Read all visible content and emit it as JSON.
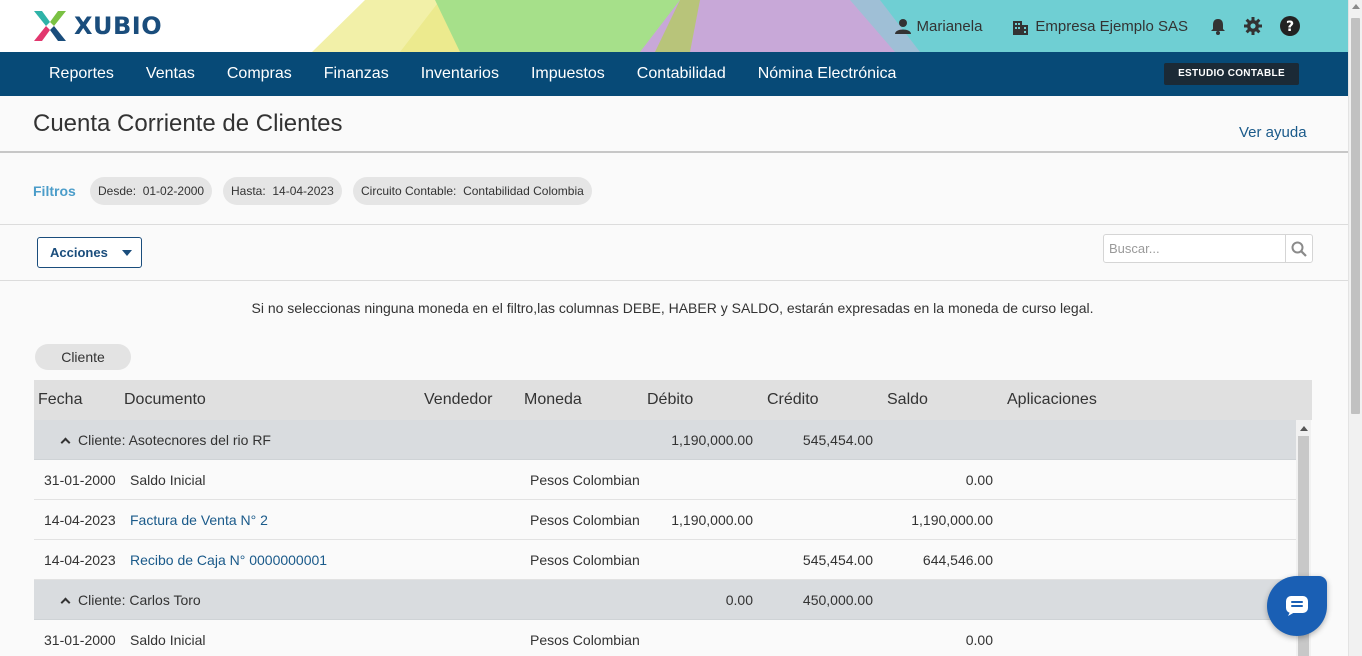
{
  "brand": {
    "name": "XUBIO"
  },
  "topbar": {
    "user": "Marianela",
    "company": "Empresa Ejemplo SAS",
    "icons": [
      "user-icon",
      "building-icon",
      "bell-icon",
      "gear-icon",
      "help-icon"
    ]
  },
  "nav": {
    "items": [
      "Reportes",
      "Ventas",
      "Compras",
      "Finanzas",
      "Inventarios",
      "Impuestos",
      "Contabilidad",
      "Nómina Electrónica"
    ],
    "studio_button": "ESTUDIO CONTABLE"
  },
  "page": {
    "title": "Cuenta Corriente de Clientes",
    "help_link": "Ver ayuda"
  },
  "filters": {
    "label": "Filtros",
    "chips": [
      {
        "name": "Desde:",
        "value": "01-02-2000"
      },
      {
        "name": "Hasta:",
        "value": "14-04-2023"
      },
      {
        "name": "Circuito Contable:",
        "value": "Contabilidad Colombia"
      }
    ]
  },
  "actions": {
    "label": "Acciones"
  },
  "search": {
    "placeholder": "Buscar..."
  },
  "notice": "Si no seleccionas ninguna moneda en el filtro,las columnas DEBE, HABER y SALDO, estarán expresadas en la moneda de curso legal.",
  "grouping_chip": "Cliente",
  "table": {
    "columns": [
      "Fecha",
      "Documento",
      "Vendedor",
      "Moneda",
      "Débito",
      "Crédito",
      "Saldo",
      "Aplicaciones"
    ],
    "groups": [
      {
        "label": "Cliente: Asotecnores del rio RF",
        "debito": "1,190,000.00",
        "credito": "545,454.00",
        "rows": [
          {
            "fecha": "31-01-2000",
            "documento": "Saldo Inicial",
            "link": false,
            "moneda": "Pesos Colombian",
            "debito": "",
            "credito": "",
            "saldo": "0.00"
          },
          {
            "fecha": "14-04-2023",
            "documento": "Factura de Venta N° 2",
            "link": true,
            "moneda": "Pesos Colombian",
            "debito": "1,190,000.00",
            "credito": "",
            "saldo": "1,190,000.00"
          },
          {
            "fecha": "14-04-2023",
            "documento": "Recibo de Caja N° 0000000001",
            "link": true,
            "moneda": "Pesos Colombian",
            "debito": "",
            "credito": "545,454.00",
            "saldo": "644,546.00"
          }
        ]
      },
      {
        "label": "Cliente: Carlos Toro",
        "debito": "0.00",
        "credito": "450,000.00",
        "rows": [
          {
            "fecha": "31-01-2000",
            "documento": "Saldo Inicial",
            "link": false,
            "moneda": "Pesos Colombian",
            "debito": "",
            "credito": "",
            "saldo": "0.00"
          }
        ]
      }
    ]
  },
  "colors": {
    "nav_bg": "#074a77",
    "brand_blue": "#1a4d7c",
    "filters_label": "#4a9cc9",
    "link": "#1a5a8a",
    "group_row": "#d9dcdf",
    "header_teal": "#6fcfd3",
    "chat_button": "#1a5fb4"
  }
}
